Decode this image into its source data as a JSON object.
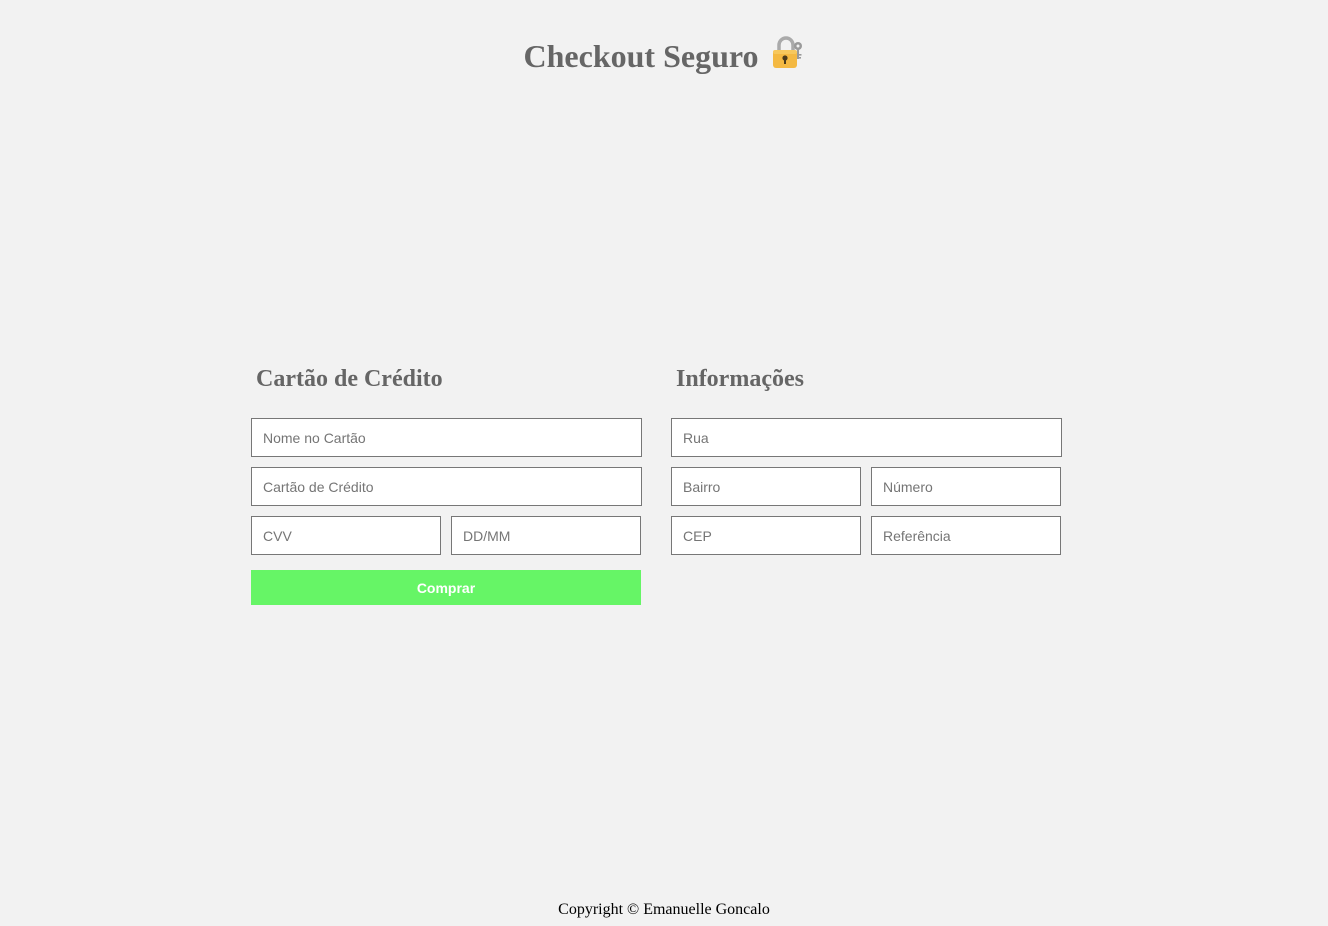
{
  "header": {
    "title": "Checkout Seguro",
    "title_icon": "locked-with-key-icon"
  },
  "credit_card": {
    "title": "Cartão de Crédito",
    "name_placeholder": "Nome no Cartão",
    "number_placeholder": "Cartão de Crédito",
    "cvv_placeholder": "CVV",
    "expiry_placeholder": "DD/MM",
    "buy_label": "Comprar"
  },
  "info": {
    "title": "Informações",
    "street_placeholder": "Rua",
    "neighborhood_placeholder": "Bairro",
    "number_placeholder": "Número",
    "zip_placeholder": "CEP",
    "reference_placeholder": "Referência"
  },
  "footer": {
    "text": "Copyright © Emanuelle Goncalo"
  },
  "colors": {
    "background": "#f2f2f2",
    "heading": "#666666",
    "button": "#66f566",
    "button_text": "#ffffff",
    "field_border": "#777777"
  }
}
